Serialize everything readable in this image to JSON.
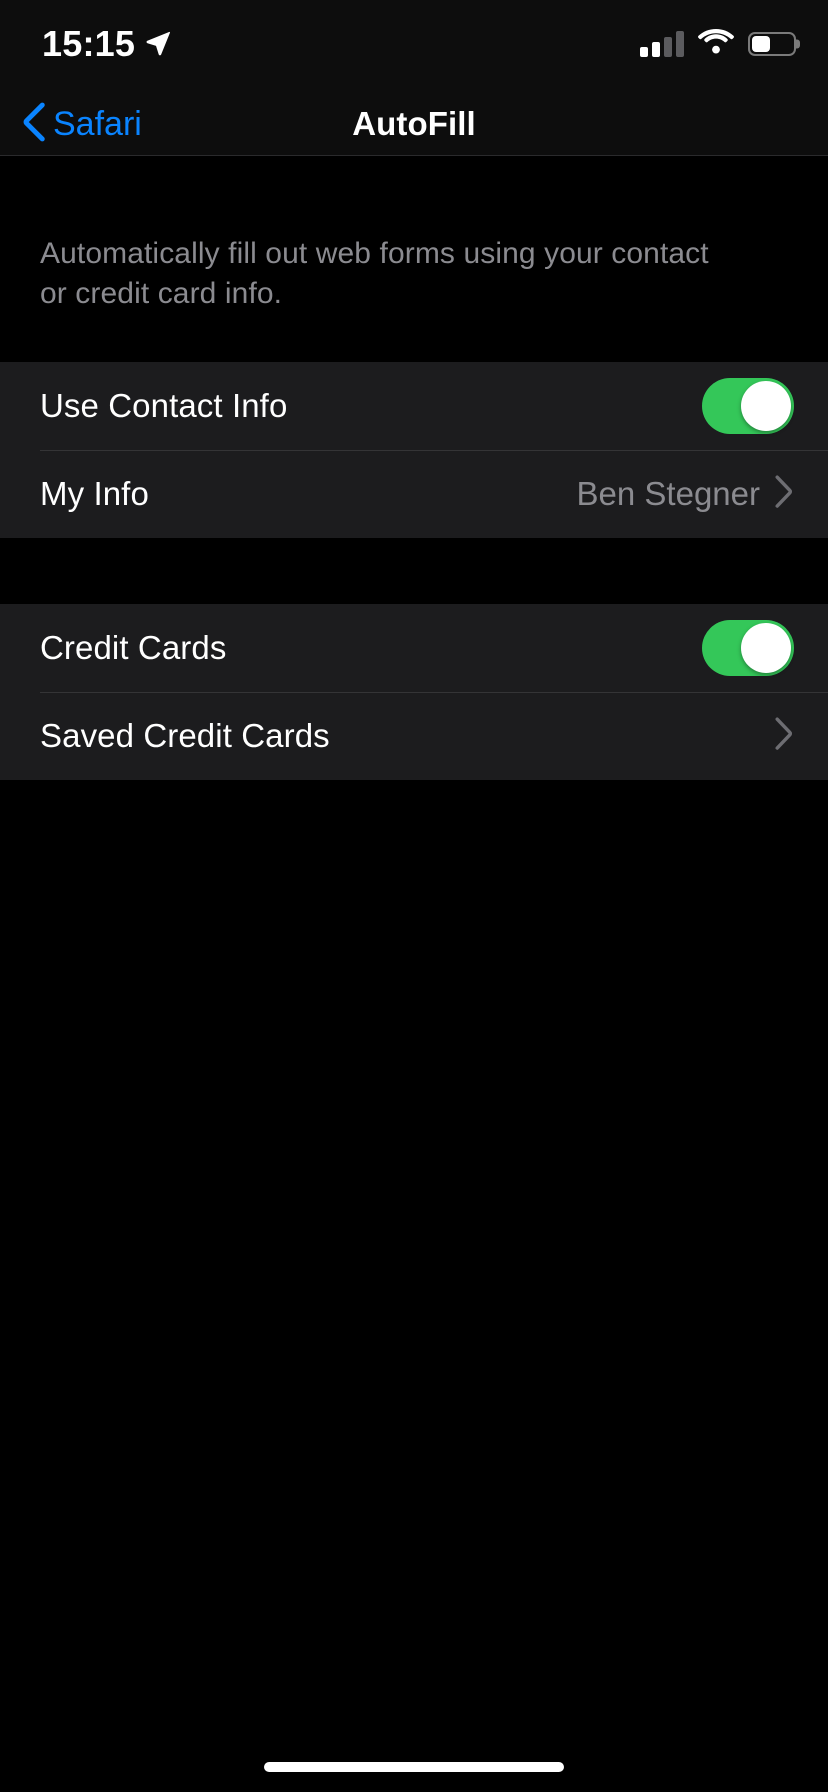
{
  "status_bar": {
    "time": "15:15",
    "location_icon": "location-arrow-icon",
    "signal_icon": "cellular-signal-icon",
    "signal_bars_total": 4,
    "signal_bars_filled": 2,
    "wifi_icon": "wifi-icon",
    "wifi_strength": "full",
    "battery_icon": "battery-icon",
    "battery_percent": 44
  },
  "nav_bar": {
    "back_label": "Safari",
    "back_icon": "chevron-left-icon",
    "title": "AutoFill"
  },
  "description": "Automatically fill out web forms using your contact or credit card info.",
  "sections": [
    {
      "rows": [
        {
          "label": "Use Contact Info",
          "type": "toggle",
          "value": "on"
        },
        {
          "label": "My Info",
          "type": "disclosure",
          "value": "Ben Stegner",
          "accessory_icon": "chevron-right-icon"
        }
      ]
    },
    {
      "rows": [
        {
          "label": "Credit Cards",
          "type": "toggle",
          "value": "on"
        },
        {
          "label": "Saved Credit Cards",
          "type": "disclosure",
          "value": "",
          "accessory_icon": "chevron-right-icon"
        }
      ]
    }
  ],
  "colors": {
    "page_background": "#000000",
    "row_background": "#1c1c1e",
    "separator": "#343436",
    "accent_blue": "#0a84ff",
    "toggle_on_green": "#34c759",
    "primary_text": "#ffffff",
    "secondary_text": "#8b8b90"
  },
  "home_indicator": "home-indicator"
}
